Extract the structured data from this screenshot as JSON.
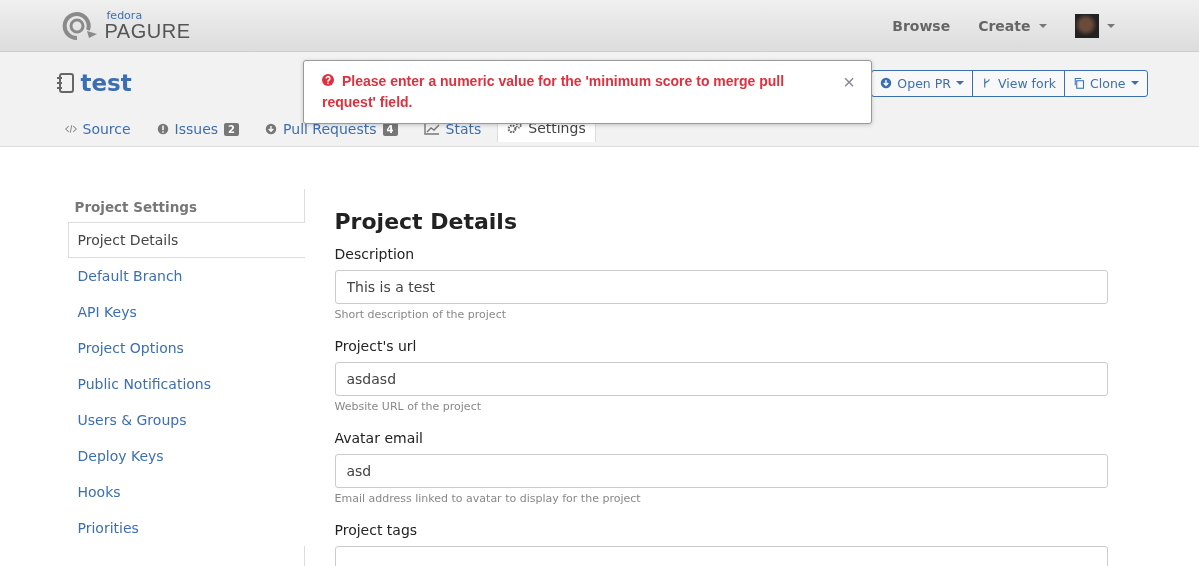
{
  "header": {
    "logo_small": "fedora",
    "logo_big": "PAGURE",
    "nav": [
      {
        "label": "Browse",
        "dropdown": false
      },
      {
        "label": "Create",
        "dropdown": true
      }
    ]
  },
  "repo": {
    "name": "test",
    "actions": [
      {
        "label": "Open PR",
        "kind": "pr",
        "dropdown": true
      },
      {
        "label": "View fork",
        "kind": "fork",
        "dropdown": false
      },
      {
        "label": "Clone",
        "kind": "clone",
        "dropdown": true
      }
    ]
  },
  "tabs": [
    {
      "label": "Source",
      "kind": "code",
      "selected": false
    },
    {
      "label": "Issues",
      "kind": "issue",
      "count": "2",
      "selected": false
    },
    {
      "label": "Pull Requests",
      "kind": "pr",
      "count": "4",
      "selected": false
    },
    {
      "label": "Stats",
      "kind": "stats",
      "selected": false
    },
    {
      "label": "Settings",
      "kind": "gear",
      "selected": true
    }
  ],
  "alert": {
    "message": "Please enter a numeric value for the 'minimum score to merge pull request' field.",
    "close": "×"
  },
  "sidebar": {
    "title": "Project Settings",
    "items": [
      {
        "label": "Project Details",
        "selected": true
      },
      {
        "label": "Default Branch",
        "selected": false
      },
      {
        "label": "API Keys",
        "selected": false
      },
      {
        "label": "Project Options",
        "selected": false
      },
      {
        "label": "Public Notifications",
        "selected": false
      },
      {
        "label": "Users & Groups",
        "selected": false
      },
      {
        "label": "Deploy Keys",
        "selected": false
      },
      {
        "label": "Hooks",
        "selected": false
      },
      {
        "label": "Priorities",
        "selected": false
      }
    ]
  },
  "form": {
    "title": "Project Details",
    "fields": [
      {
        "label": "Description",
        "value": "This is a test",
        "help": "Short description of the project"
      },
      {
        "label": "Project's url",
        "value": "asdasd",
        "help": "Website URL of the project"
      },
      {
        "label": "Avatar email",
        "value": "asd",
        "help": "Email address linked to avatar to display for the project"
      },
      {
        "label": "Project tags"
      }
    ]
  }
}
